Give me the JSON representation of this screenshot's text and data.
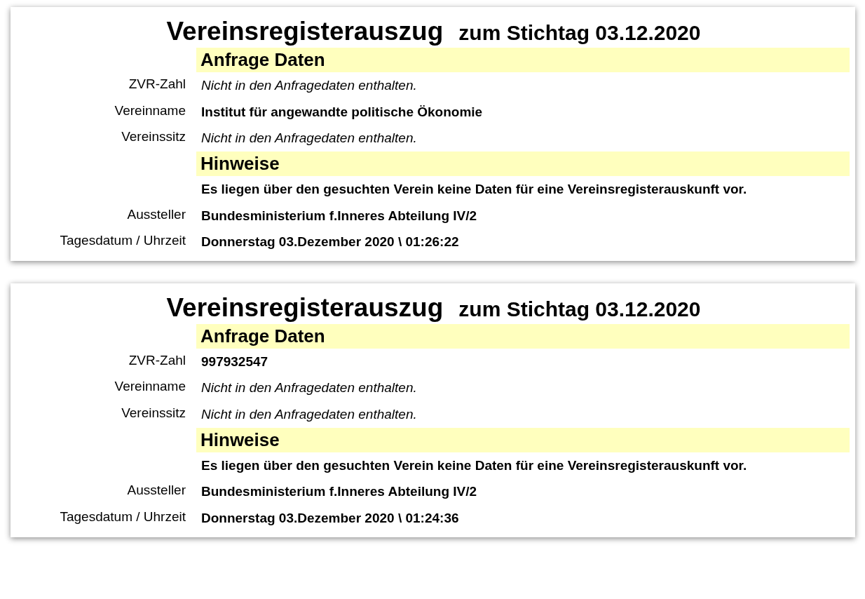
{
  "documents": [
    {
      "title": "Vereinsregisterauszug",
      "subtitle": "zum Stichtag 03.12.2020",
      "sections": [
        {
          "heading": "Anfrage Daten",
          "rows": [
            {
              "label": "ZVR-Zahl",
              "value": "Nicht in den Anfragedaten enthalten.",
              "kind": "note"
            },
            {
              "label": "Vereinname",
              "value": "Institut für angewandte politische Ökonomie",
              "kind": "value"
            },
            {
              "label": "Vereinssitz",
              "value": "Nicht in den Anfragedaten enthalten.",
              "kind": "note"
            }
          ]
        },
        {
          "heading": "Hinweise",
          "rows": [
            {
              "value": "Es liegen über den gesuchten Verein keine Daten für eine Vereinsregisterauskunft vor.",
              "kind": "value"
            },
            {
              "label": "Aussteller",
              "value": "Bundesministerium f.Inneres Abteilung IV/2",
              "kind": "value"
            },
            {
              "label": "Tagesdatum / Uhrzeit",
              "value": "Donnerstag 03.Dezember 2020 \\ 01:26:22",
              "kind": "value"
            }
          ]
        }
      ]
    },
    {
      "title": "Vereinsregisterauszug",
      "subtitle": "zum Stichtag 03.12.2020",
      "sections": [
        {
          "heading": "Anfrage Daten",
          "rows": [
            {
              "label": "ZVR-Zahl",
              "value": "997932547",
              "kind": "value"
            },
            {
              "label": "Vereinname",
              "value": "Nicht in den Anfragedaten enthalten.",
              "kind": "note"
            },
            {
              "label": "Vereinssitz",
              "value": "Nicht in den Anfragedaten enthalten.",
              "kind": "note"
            }
          ]
        },
        {
          "heading": "Hinweise",
          "rows": [
            {
              "value": "Es liegen über den gesuchten Verein keine Daten für eine Vereinsregisterauskunft vor.",
              "kind": "value"
            },
            {
              "label": "Aussteller",
              "value": "Bundesministerium f.Inneres Abteilung IV/2",
              "kind": "value"
            },
            {
              "label": "Tagesdatum / Uhrzeit",
              "value": "Donnerstag 03.Dezember 2020 \\ 01:24:36",
              "kind": "value"
            }
          ]
        }
      ]
    }
  ]
}
